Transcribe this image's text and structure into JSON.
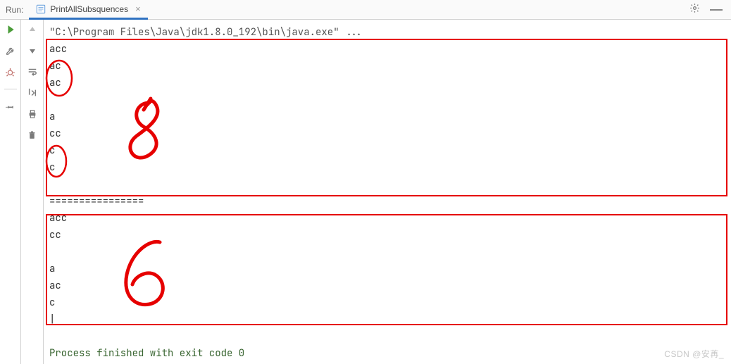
{
  "titlebar": {
    "run_label": "Run:",
    "tab_label": "PrintAllSubsquences"
  },
  "console": {
    "header": "\"C:\\Program Files\\Java\\jdk1.8.0_192\\bin\\java.exe\" ...",
    "lines_top": [
      "acc",
      "ac",
      "ac",
      "",
      "a",
      "cc",
      "c",
      "c",
      ""
    ],
    "separator": "================",
    "lines_bottom": [
      "acc",
      "cc",
      "",
      "a",
      "ac",
      "c"
    ],
    "finished_msg": "Process finished with exit code 0"
  },
  "annotations": {
    "top_count_glyph": "8",
    "bottom_count_glyph": "6"
  },
  "watermark": "CSDN @安苒_"
}
